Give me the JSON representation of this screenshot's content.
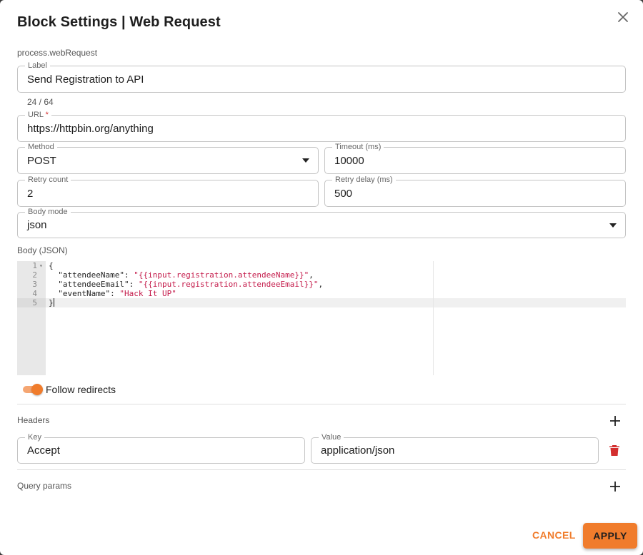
{
  "dialog": {
    "title": "Block Settings | Web Request",
    "subtitle": "process.webRequest",
    "close_icon": "close-icon"
  },
  "fields": {
    "label": {
      "label": "Label",
      "value": "Send Registration to API",
      "counter": "24 / 64"
    },
    "url": {
      "label": "URL",
      "required_mark": "*",
      "value": "https://httpbin.org/anything"
    },
    "method": {
      "label": "Method",
      "value": "POST"
    },
    "timeout": {
      "label": "Timeout (ms)",
      "value": "10000"
    },
    "retry_count": {
      "label": "Retry count",
      "value": "2"
    },
    "retry_delay": {
      "label": "Retry delay (ms)",
      "value": "500"
    },
    "body_mode": {
      "label": "Body mode",
      "value": "json"
    }
  },
  "body": {
    "label": "Body (JSON)",
    "line_numbers": [
      "1",
      "2",
      "3",
      "4",
      "5"
    ],
    "lines": [
      {
        "key": "",
        "value": "",
        "raw": "{"
      },
      {
        "key": "\"attendeeName\"",
        "sep": ": ",
        "value": "\"{{input.registration.attendeeName}}\"",
        "tail": ","
      },
      {
        "key": "\"attendeeEmail\"",
        "sep": ": ",
        "value": "\"{{input.registration.attendeeEmail}}\"",
        "tail": ","
      },
      {
        "key": "\"eventName\"",
        "sep": ": ",
        "value": "\"Hack It UP\"",
        "tail": ""
      },
      {
        "key": "",
        "value": "",
        "raw": "}"
      }
    ]
  },
  "follow_redirects": {
    "label": "Follow redirects",
    "enabled": true
  },
  "headers": {
    "label": "Headers",
    "add_icon": "plus-icon",
    "rows": [
      {
        "key_label": "Key",
        "key": "Accept",
        "value_label": "Value",
        "value": "application/json",
        "delete_icon": "trash-icon"
      }
    ]
  },
  "query_params": {
    "label": "Query params",
    "add_icon": "plus-icon"
  },
  "actions": {
    "cancel": "CANCEL",
    "apply": "APPLY"
  },
  "colors": {
    "accent": "#f07c2c",
    "danger": "#d32f2f",
    "string": "#c41a4a"
  }
}
